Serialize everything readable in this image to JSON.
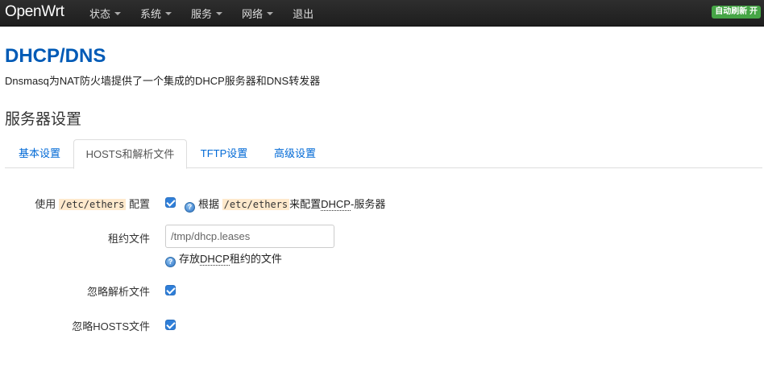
{
  "navbar": {
    "brand": "OpenWrt",
    "menu": [
      {
        "label": "状态",
        "has_caret": true
      },
      {
        "label": "系统",
        "has_caret": true
      },
      {
        "label": "服务",
        "has_caret": true
      },
      {
        "label": "网络",
        "has_caret": true
      },
      {
        "label": "退出",
        "has_caret": false
      }
    ],
    "refresh_badge": "自动刷新 开"
  },
  "page": {
    "title": "DHCP/DNS",
    "description": "Dnsmasq为NAT防火墙提供了一个集成的DHCP服务器和DNS转发器",
    "section_title": "服务器设置"
  },
  "tabs": [
    {
      "label": "基本设置",
      "active": false
    },
    {
      "label": "HOSTS和解析文件",
      "active": true
    },
    {
      "label": "TFTP设置",
      "active": false
    },
    {
      "label": "高级设置",
      "active": false
    }
  ],
  "form": {
    "ethers": {
      "label_prefix": "使用",
      "label_code": "/etc/ethers",
      "label_suffix": "配置",
      "checked": true,
      "help_prefix": "根据",
      "help_code": "/etc/ethers",
      "help_middle": "来配置",
      "help_abbr": "DHCP",
      "help_suffix": "-服务器"
    },
    "leasefile": {
      "label": "租约文件",
      "placeholder": "/tmp/dhcp.leases",
      "value": "",
      "help_prefix": "存放",
      "help_abbr": "DHCP",
      "help_suffix": "租约的文件"
    },
    "noresolv": {
      "label": "忽略解析文件",
      "checked": true
    },
    "nohosts": {
      "label": "忽略HOSTS文件",
      "checked": true
    }
  },
  "colors": {
    "navbar_bg": "#222222",
    "title_blue": "#005ab6",
    "link_blue": "#0069d6",
    "badge_green": "#46a546",
    "code_bg": "#fee9cc",
    "checkbox_blue": "#2f7fd9"
  }
}
